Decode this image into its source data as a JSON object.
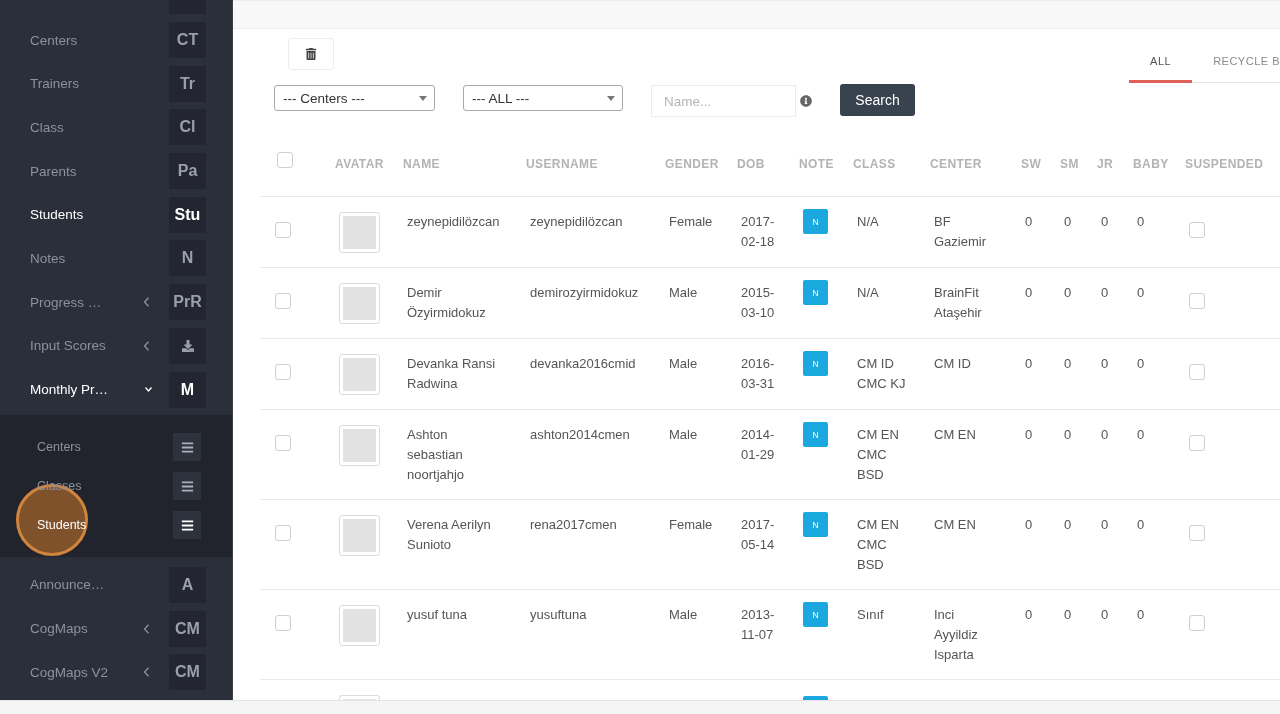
{
  "sidebar": {
    "items": [
      {
        "kind": "cut_off"
      },
      {
        "kind": "letters",
        "label": "Centers",
        "badge": "CT",
        "selected": false
      },
      {
        "kind": "letters",
        "label": "Trainers",
        "badge": "Tr",
        "selected": false
      },
      {
        "kind": "letters",
        "label": "Class",
        "badge": "Cl",
        "selected": false
      },
      {
        "kind": "letters",
        "label": "Parents",
        "badge": "Pa",
        "selected": false
      },
      {
        "kind": "letters",
        "label": "Students",
        "badge": "Stu",
        "selected": true
      },
      {
        "kind": "letters",
        "label": "Notes",
        "badge": "N",
        "selected": false
      },
      {
        "kind": "letters",
        "label": "Progress …",
        "badge": "PrR",
        "selected": false,
        "expanded": false
      },
      {
        "kind": "icon",
        "label": "Input Scores",
        "selected": false,
        "expanded": false
      },
      {
        "kind": "letters",
        "label": "Monthly Pr…",
        "badge": "M",
        "selected": true,
        "expanded": true,
        "children": [
          {
            "label": "Centers",
            "selected": false,
            "clicked": false
          },
          {
            "label": "Classes",
            "selected": false,
            "clicked": false
          },
          {
            "label": "Students",
            "selected": true,
            "clicked": true
          }
        ]
      },
      {
        "kind": "letters",
        "label": "Announce…",
        "badge": "A",
        "selected": false
      },
      {
        "kind": "letters",
        "label": "CogMaps",
        "badge": "CM",
        "selected": false,
        "expanded": false
      },
      {
        "kind": "letters",
        "label": "CogMaps V2",
        "badge": "CM",
        "selected": false,
        "expanded": false
      }
    ]
  },
  "tabs": [
    {
      "label": "ALL",
      "selected": true
    },
    {
      "label": "RECYCLE B",
      "selected": false
    }
  ],
  "filters": {
    "center_select": "--- Centers ---",
    "status_select": "--- ALL ---",
    "search": {
      "placeholder": "Name..."
    },
    "search_button": "Search"
  },
  "table": {
    "select_all": {
      "checked": false
    },
    "columns": [
      "AVATAR",
      "NAME",
      "USERNAME",
      "GENDER",
      "DOB",
      "NOTE",
      "CLASS",
      "CENTER",
      "SW",
      "SM",
      "JR",
      "BABY",
      "SUSPENDED"
    ],
    "rows": [
      {
        "kind": "student",
        "checked": false,
        "name": "zeynepidilözcan",
        "username": "zeynepidilözcan",
        "gender": "Female",
        "dob": "2017-02-18",
        "note": "N",
        "class": "N/A",
        "center": "BF Gaziemir",
        "sw": "0",
        "sm": "0",
        "jr": "0",
        "baby": "0",
        "suspended": false
      },
      {
        "kind": "student",
        "checked": false,
        "name": "Demir Özyirmidokuz",
        "username": "demirozyirmidokuz",
        "gender": "Male",
        "dob": "2015-03-10",
        "note": "N",
        "class": "N/A",
        "center": "BrainFit Ataşehir",
        "sw": "0",
        "sm": "0",
        "jr": "0",
        "baby": "0",
        "suspended": false
      },
      {
        "kind": "student",
        "checked": false,
        "name": "Devanka Ransi Radwina",
        "username": "devanka2016cmid",
        "gender": "Male",
        "dob": "2016-03-31",
        "note": "N",
        "class": "CM ID CMC KJ",
        "center": "CM ID",
        "sw": "0",
        "sm": "0",
        "jr": "0",
        "baby": "0",
        "suspended": false
      },
      {
        "kind": "student",
        "checked": false,
        "name": "Ashton sebastian noortjahjo",
        "username": "ashton2014cmen",
        "gender": "Male",
        "dob": "2014-01-29",
        "note": "N",
        "class": "CM EN CMC BSD",
        "center": "CM EN",
        "sw": "0",
        "sm": "0",
        "jr": "0",
        "baby": "0",
        "suspended": false
      },
      {
        "kind": "student",
        "checked": false,
        "name": "Verena Aerilyn Sunioto",
        "username": "rena2017cmen",
        "gender": "Female",
        "dob": "2017-05-14",
        "note": "N",
        "class": "CM EN CMC BSD",
        "center": "CM EN",
        "sw": "0",
        "sm": "0",
        "jr": "0",
        "baby": "0",
        "suspended": false
      },
      {
        "kind": "student",
        "checked": false,
        "name": "yusuf tuna",
        "username": "yusuftuna",
        "gender": "Male",
        "dob": "2013-11-07",
        "note": "N",
        "class": "Sınıf",
        "center": "Inci Ayyildiz Isparta",
        "sw": "0",
        "sm": "0",
        "jr": "0",
        "baby": "0",
        "suspended": false
      },
      {
        "kind": "cut_off"
      }
    ]
  }
}
